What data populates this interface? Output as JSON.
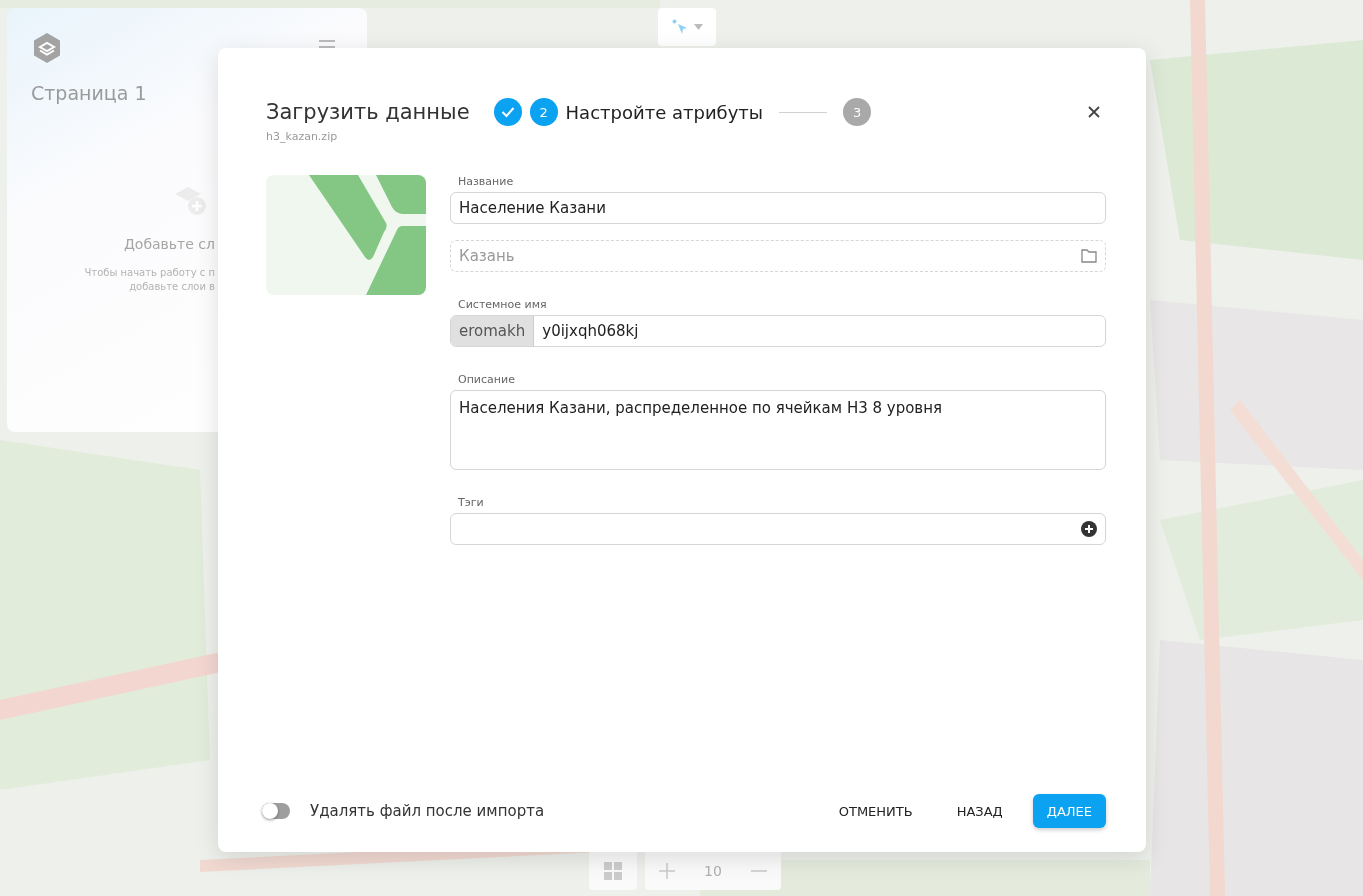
{
  "panel": {
    "title": "Страница 1",
    "empty_title": "Добавьте сл",
    "empty_hint": [
      "Чтобы начать работу с п",
      "добавьте слои в"
    ]
  },
  "map_controls": {
    "zoom": "10"
  },
  "dialog": {
    "title": "Загрузить данные",
    "file": "h3_kazan.zip",
    "steps": [
      {
        "done": true,
        "selected": false
      },
      {
        "done": false,
        "selected": true,
        "number": "2",
        "label": "Настройте атрибуты"
      },
      {
        "done": false,
        "selected": false,
        "number": "3"
      }
    ],
    "name": {
      "label": "Название",
      "value": "Население Казани"
    },
    "folder": {
      "placeholder": "Казань"
    },
    "system_name": {
      "label": "Системное имя",
      "prefix": "eromakh",
      "value": "y0ijxqh068kj"
    },
    "description": {
      "label": "Описание",
      "value": "Населения Казани, распределенное по ячейкам H3 8 уровня"
    },
    "tags": {
      "label": "Тэги"
    },
    "delete_toggle": {
      "label": "Удалять файл после импорта",
      "on": false
    },
    "buttons": [
      {
        "label": "ОТМЕНИТЬ",
        "kind": "text"
      },
      {
        "label": "НАЗАД",
        "kind": "text"
      },
      {
        "label": "ДАЛЕЕ",
        "kind": "primary"
      }
    ]
  }
}
